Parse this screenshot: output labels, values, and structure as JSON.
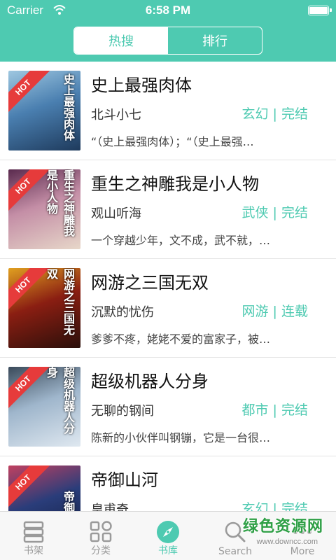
{
  "status": {
    "carrier": "Carrier",
    "time": "6:58 PM"
  },
  "segmented": {
    "options": [
      "热搜",
      "排行"
    ],
    "selected": "热搜"
  },
  "books": [
    {
      "title": "史上最强肉体",
      "author": "北斗小七",
      "tag": "玄幻 | 完结",
      "desc": "“（史上最强肉体）；“（史上最强…",
      "hot": "HOT",
      "colors": [
        "#1e3a5c",
        "#4a7fb0",
        "#9ec7e0"
      ]
    },
    {
      "title": "重生之神雕我是小人物",
      "author": "观山听海",
      "tag": "武侠 | 完结",
      "desc": "一个穿越少年，文不成，武不就，…",
      "hot": "HOT",
      "colors": [
        "#e7d7c9",
        "#c48ea6",
        "#5a2a4e"
      ]
    },
    {
      "title": "网游之三国无双",
      "author": "沉默的忧伤",
      "tag": "网游 | 连载",
      "desc": "爹爹不疼，姥姥不爱的富家子，被…",
      "hot": "HOT",
      "colors": [
        "#2a0f0a",
        "#8a1e12",
        "#e0a020"
      ]
    },
    {
      "title": "超级机器人分身",
      "author": "无聊的钢间",
      "tag": "都市 | 完结",
      "desc": "陈新的小伙伴叫钢镚，它是一台很…",
      "hot": "HOT",
      "colors": [
        "#dfe8f0",
        "#9fb6cc",
        "#3a4a5a"
      ]
    },
    {
      "title": "帝御山河",
      "author": "皇甫奇",
      "tag": "玄幻 | 完结",
      "desc": "",
      "hot": "HOT",
      "colors": [
        "#0f1a3a",
        "#2a3d7a",
        "#c04060"
      ]
    }
  ],
  "tabbar": {
    "items": [
      {
        "label": "书架",
        "icon": "bookshelf-icon"
      },
      {
        "label": "分类",
        "icon": "category-grid-icon"
      },
      {
        "label": "书库",
        "icon": "compass-icon"
      },
      {
        "label": "Search",
        "icon": "search-icon"
      },
      {
        "label": "More",
        "icon": "more-icon"
      }
    ],
    "active": "书库",
    "accent": "#4ecab1"
  },
  "watermark": {
    "title": "绿色资源网",
    "url": "www.downcc.com"
  }
}
